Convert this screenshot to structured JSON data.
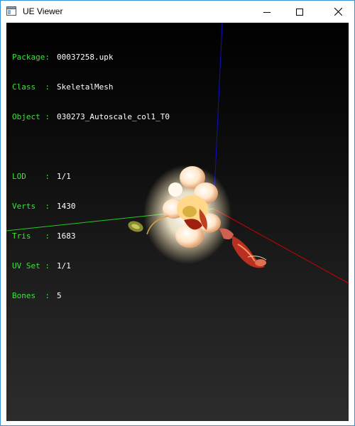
{
  "window": {
    "title": "UE Viewer"
  },
  "info": {
    "package_label": "Package:",
    "package_value": "00037258.upk",
    "class_label": "Class  :",
    "class_value": "SkeletalMesh",
    "object_label": "Object :",
    "object_value": "030273_Autoscale_col1_T0",
    "lod_label": "LOD    :",
    "lod_value": "1/1",
    "verts_label": "Verts  :",
    "verts_value": "1430",
    "tris_label": "Tris   :",
    "tris_value": "1683",
    "uvset_label": "UV Set :",
    "uvset_value": "1/1",
    "bones_label": "Bones  :",
    "bones_value": "5"
  },
  "colors": {
    "label_text": "#3ee03e",
    "value_text": "#ffffff",
    "axis_x": "#cc0000",
    "axis_y": "#22cc22",
    "axis_z": "#1010c0"
  },
  "icons": [
    "app-window-icon",
    "minimize-icon",
    "maximize-icon",
    "close-icon"
  ]
}
